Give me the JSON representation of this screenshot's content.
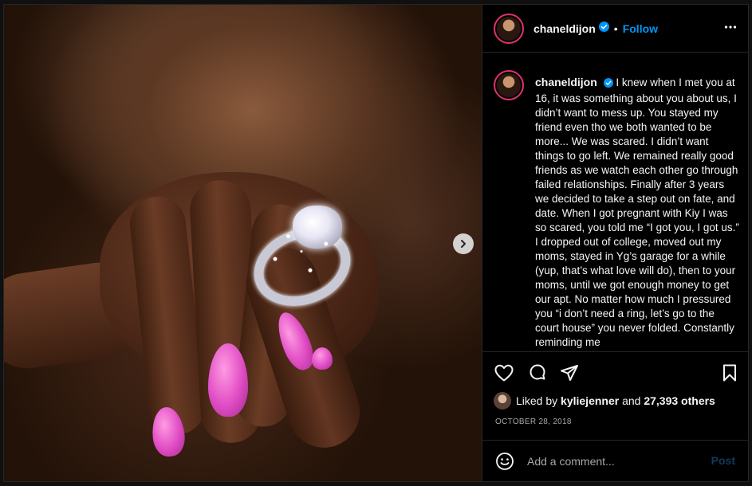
{
  "post": {
    "username": "chaneldijon",
    "follow_label": "Follow",
    "separator": "•",
    "caption": "I knew when I met you at 16, it was something about you about us, I didn’t want to mess up. You stayed my friend even tho we both wanted to be more... We was scared. I didn’t want things to go left. We remained really good friends as we watch each other go through failed relationships. Finally after 3 years we decided to take a step out on fate, and date. When I got pregnant with Kiy I was so scared, you told me “I got you, I got us.” I dropped out of college, moved out my moms, stayed in Yg’s garage for a while (yup, that’s what love will do), then to your moms, until we got enough money to get our apt. No matter how much I pressured you “i don’t need a ring, let’s go to the court house” you never folded. Constantly reminding me",
    "liked_by_prefix": "Liked by",
    "liked_by_user": "kyliejenner",
    "liked_by_and": "and",
    "liked_by_count": "27,393 others",
    "date": "OCTOBER 28, 2018"
  },
  "comment": {
    "placeholder": "Add a comment...",
    "post_label": "Post"
  },
  "icons": {
    "verified": "verified-badge-icon",
    "more": "more-options-icon",
    "next": "chevron-right-icon",
    "like": "heart-icon",
    "comment": "comment-icon",
    "share": "share-icon",
    "save": "bookmark-icon",
    "emoji": "emoji-icon"
  },
  "colors": {
    "accent": "#0095f6",
    "ring": "#e1306c",
    "background": "#000000",
    "muted": "#a8a8a8"
  }
}
